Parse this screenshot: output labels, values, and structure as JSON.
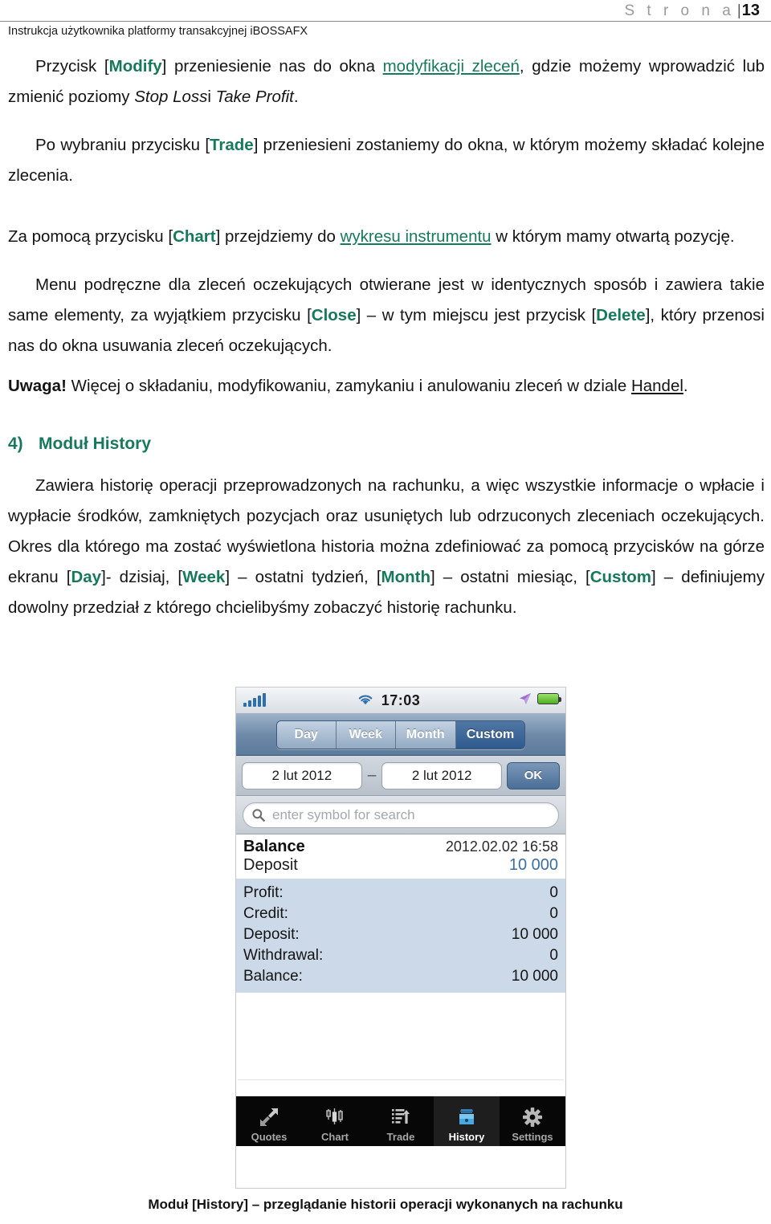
{
  "header": {
    "page_label": "S t r o n a",
    "page_separator": "|",
    "page_number": "13",
    "doc_title": "Instrukcja użytkownika platformy transakcyjnej iBOSSAFX"
  },
  "colors": {
    "accent_green": "#18795a",
    "link_underline": "#18795a",
    "amount_blue": "#3a6ea5",
    "detail_panel": "#ccd9e8"
  },
  "body": {
    "p1": {
      "t1": "Przycisk [",
      "b1": "Modify",
      "t2": "] przeniesienie nas do okna ",
      "link1": "modyfikacji zleceń",
      "t3": ", gdzie możemy wprowadzić lub zmienić poziomy ",
      "i1": "Stop Loss",
      "t4": "i ",
      "i2": "Take Profit",
      "t5": "."
    },
    "p2": {
      "t1": "Po wybraniu przycisku [",
      "b1": "Trade",
      "t2": "] przeniesieni zostaniemy do okna, w którym możemy składać kolejne zlecenia."
    },
    "p3": {
      "t1": "Za pomocą przycisku [",
      "b1": "Chart",
      "t2": "] przejdziemy do ",
      "link1": "wykresu instrumentu",
      "t3": " w którym mamy otwartą pozycję."
    },
    "p4": {
      "t1": "Menu podręczne dla zleceń oczekujących otwierane jest w identycznych sposób i zawiera takie same elementy, za wyjątkiem przycisku [",
      "b1": "Close",
      "t2": "] – w tym miejscu jest przycisk [",
      "b2": "Delete",
      "t3": "], który przenosi nas do okna usuwania zleceń oczekujących."
    },
    "p5": {
      "b1": "Uwaga!",
      "t1": " Więcej o składaniu, modyfikowaniu, zamykaniu i anulowaniu zleceń w dziale ",
      "link1": "Handel",
      "t2": "."
    },
    "section": {
      "number": "4)",
      "title": "Moduł History"
    },
    "p6": {
      "t1": "Zawiera historię operacji przeprowadzonych na rachunku, a więc wszystkie informacje o wpłacie i wypłacie środków, zamkniętych pozycjach oraz usuniętych lub odrzuconych zleceniach oczekujących. Okres dla którego ma zostać wyświetlona historia można zdefiniować za pomocą przycisków na górze ekranu [",
      "b1": "Day",
      "t2": "]- dzisiaj, [",
      "b2": "Week",
      "t3": "] – ostatni tydzień, [",
      "b3": "Month",
      "t4": "] – ostatni miesiąc, [",
      "b4": "Custom",
      "t5": "] – definiujemy dowolny przedział z którego chcielibyśmy zobaczyć historię rachunku."
    }
  },
  "screenshot": {
    "statusbar": {
      "time": "17:03",
      "signal_icon": "signal-bars-icon",
      "wifi_icon": "wifi-icon",
      "location_icon": "location-arrow-icon",
      "battery_icon": "battery-icon"
    },
    "segments": [
      {
        "label": "Day",
        "active": false
      },
      {
        "label": "Week",
        "active": false
      },
      {
        "label": "Month",
        "active": false
      },
      {
        "label": "Custom",
        "active": true
      }
    ],
    "date_range": {
      "from": "2 lut 2012",
      "separator": "–",
      "to": "2 lut 2012",
      "ok_label": "OK"
    },
    "search": {
      "placeholder": "enter symbol for search",
      "icon": "search-icon"
    },
    "balance_header": {
      "title": "Balance",
      "timestamp": "2012.02.02 16:58",
      "subtitle": "Deposit",
      "amount": "10 000"
    },
    "details": [
      {
        "label": "Profit:",
        "value": "0"
      },
      {
        "label": "Credit:",
        "value": "0"
      },
      {
        "label": "Deposit:",
        "value": "10 000"
      },
      {
        "label": "Withdrawal:",
        "value": "0"
      },
      {
        "label": "Balance:",
        "value": "10 000"
      }
    ],
    "tabs": [
      {
        "label": "Quotes",
        "icon": "quotes-arrows-icon",
        "active": false
      },
      {
        "label": "Chart",
        "icon": "candlestick-chart-icon",
        "active": false
      },
      {
        "label": "Trade",
        "icon": "trade-list-icon",
        "active": false
      },
      {
        "label": "History",
        "icon": "history-tray-icon",
        "active": true
      },
      {
        "label": "Settings",
        "icon": "gear-icon",
        "active": false
      }
    ]
  },
  "caption": "Moduł [History] – przeglądanie historii operacji wykonanych na rachunku"
}
